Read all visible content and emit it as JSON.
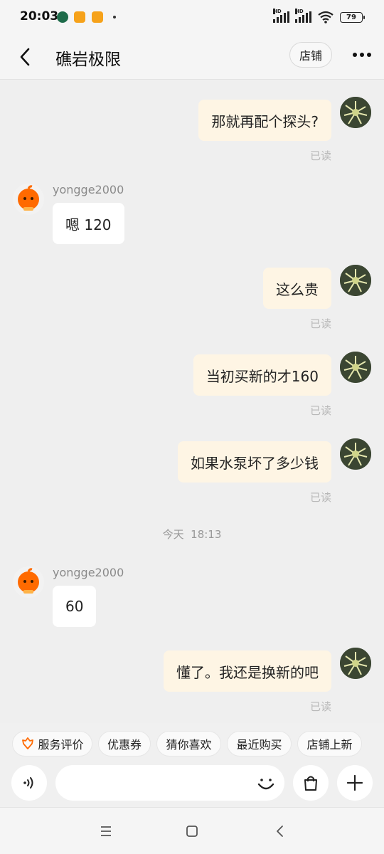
{
  "status_bar": {
    "time": "20:03",
    "battery": "79",
    "hd1": "HD",
    "hd2": "HD"
  },
  "header": {
    "title": "礁岩极限",
    "store_label": "店铺"
  },
  "messages": [
    {
      "side": "mine",
      "text": "那就再配个探头?",
      "status": "已读"
    },
    {
      "side": "theirs",
      "sender": "yongge2000",
      "text": "嗯 120"
    },
    {
      "side": "mine",
      "text": "这么贵",
      "status": "已读"
    },
    {
      "side": "mine",
      "text": "当初买新的才160",
      "status": "已读"
    },
    {
      "side": "mine",
      "text": "如果水泵坏了多少钱",
      "status": "已读"
    },
    {
      "side": "theirs",
      "sender": "yongge2000",
      "text": "60"
    },
    {
      "side": "mine",
      "text": "懂了。我还是换新的吧",
      "status": "已读"
    }
  ],
  "time_divider": "今天  18:13",
  "quick_tags": [
    "服务评价",
    "优惠券",
    "猜你喜欢",
    "最近购买",
    "店铺上新"
  ],
  "input": {
    "placeholder": ""
  },
  "colors": {
    "mine_bubble": "#fef5e4",
    "theirs_bubble": "#ffffff",
    "background": "#efefef",
    "accent_orange": "#ff6a00"
  },
  "icons": {
    "back": "chevron-left-icon",
    "more": "more-dots-icon",
    "voice": "voice-icon",
    "emoji": "smile-icon",
    "bag": "shopping-bag-icon",
    "add": "plus-icon",
    "service": "shield-flower-icon"
  }
}
